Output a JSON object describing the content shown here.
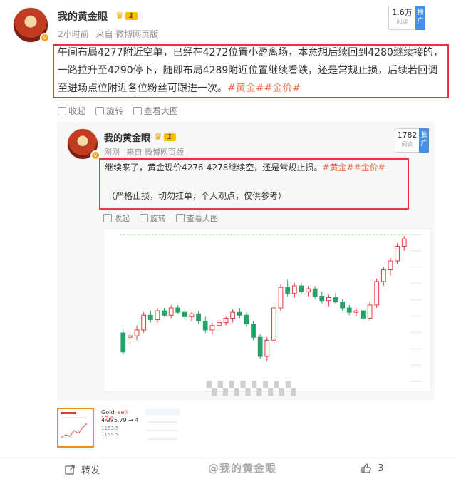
{
  "post": {
    "author": "我的黄金眼",
    "level": "1",
    "time": "2小时前",
    "source": "来自 微博网页版",
    "views": "1.6万",
    "views_label": "阅读",
    "promote": "推广",
    "text_main": "午间布局4277附近空单，已经在4272位置小盈离场，本意想后续回到4280继续接的，一路拉升至4290停下，随即布局4289附近位置继续看跌，还是常规止损，后续若回调至进场点位附近各位粉丝可跟进一次。",
    "tags": "#黄金##金价#",
    "actions": {
      "collect": "收起",
      "rotate": "旋转",
      "view_large": "查看大图"
    }
  },
  "repost": {
    "author": "我的黄金眼",
    "level": "1",
    "time": "刚刚",
    "source": "来自 微博网页版",
    "views": "1782",
    "views_label": "阅读",
    "promote": "推广",
    "text_main": "继续来了，黄金现价4276-4278继续空，还是常规止损。",
    "tags": "#黄金##金价#",
    "text_note": "（严格止损，切勿扛单，个人观点，仅供参考）",
    "actions": {
      "collect": "收起",
      "rotate": "旋转",
      "view_large": "查看大图"
    }
  },
  "thumbs": {
    "gold_label": "Gold,",
    "sell_label": "sell 12.0",
    "price": "4 275.79 → 4",
    "line3": "1153.5",
    "line4": "1155.5"
  },
  "footer": {
    "repost": "转发",
    "watermark": "@我的黄金眼",
    "likes": "3"
  },
  "colors": {
    "accent_red": "#e8353b",
    "tag_orange": "#eb7350",
    "up_candle": "#e23b3b",
    "down_candle": "#26a269"
  },
  "chart_data": {
    "type": "candlestick",
    "candles": [
      [
        0.33,
        0.36,
        0.18,
        0.2
      ],
      [
        0.3,
        0.33,
        0.25,
        0.31
      ],
      [
        0.31,
        0.38,
        0.28,
        0.35
      ],
      [
        0.35,
        0.47,
        0.33,
        0.45
      ],
      [
        0.45,
        0.48,
        0.4,
        0.42
      ],
      [
        0.42,
        0.5,
        0.4,
        0.48
      ],
      [
        0.48,
        0.5,
        0.44,
        0.45
      ],
      [
        0.45,
        0.52,
        0.43,
        0.5
      ],
      [
        0.5,
        0.52,
        0.46,
        0.47
      ],
      [
        0.47,
        0.49,
        0.42,
        0.44
      ],
      [
        0.44,
        0.47,
        0.41,
        0.46
      ],
      [
        0.46,
        0.48,
        0.39,
        0.41
      ],
      [
        0.41,
        0.44,
        0.33,
        0.35
      ],
      [
        0.35,
        0.4,
        0.32,
        0.38
      ],
      [
        0.38,
        0.42,
        0.36,
        0.4
      ],
      [
        0.4,
        0.44,
        0.38,
        0.43
      ],
      [
        0.43,
        0.49,
        0.4,
        0.47
      ],
      [
        0.47,
        0.5,
        0.43,
        0.45
      ],
      [
        0.45,
        0.47,
        0.37,
        0.39
      ],
      [
        0.39,
        0.41,
        0.28,
        0.3
      ],
      [
        0.3,
        0.32,
        0.15,
        0.17
      ],
      [
        0.17,
        0.3,
        0.14,
        0.28
      ],
      [
        0.28,
        0.52,
        0.26,
        0.5
      ],
      [
        0.5,
        0.66,
        0.48,
        0.64
      ],
      [
        0.64,
        0.69,
        0.58,
        0.6
      ],
      [
        0.6,
        0.67,
        0.57,
        0.65
      ],
      [
        0.65,
        0.67,
        0.59,
        0.61
      ],
      [
        0.61,
        0.65,
        0.58,
        0.63
      ],
      [
        0.63,
        0.65,
        0.56,
        0.58
      ],
      [
        0.58,
        0.61,
        0.53,
        0.55
      ],
      [
        0.55,
        0.59,
        0.51,
        0.57
      ],
      [
        0.57,
        0.6,
        0.53,
        0.54
      ],
      [
        0.54,
        0.56,
        0.48,
        0.5
      ],
      [
        0.5,
        0.52,
        0.45,
        0.47
      ],
      [
        0.47,
        0.5,
        0.44,
        0.48
      ],
      [
        0.48,
        0.5,
        0.41,
        0.43
      ],
      [
        0.43,
        0.54,
        0.41,
        0.52
      ],
      [
        0.52,
        0.7,
        0.5,
        0.68
      ],
      [
        0.68,
        0.78,
        0.65,
        0.76
      ],
      [
        0.76,
        0.84,
        0.72,
        0.82
      ],
      [
        0.82,
        0.94,
        0.8,
        0.92
      ],
      [
        0.92,
        0.99,
        0.89,
        0.97
      ]
    ]
  }
}
